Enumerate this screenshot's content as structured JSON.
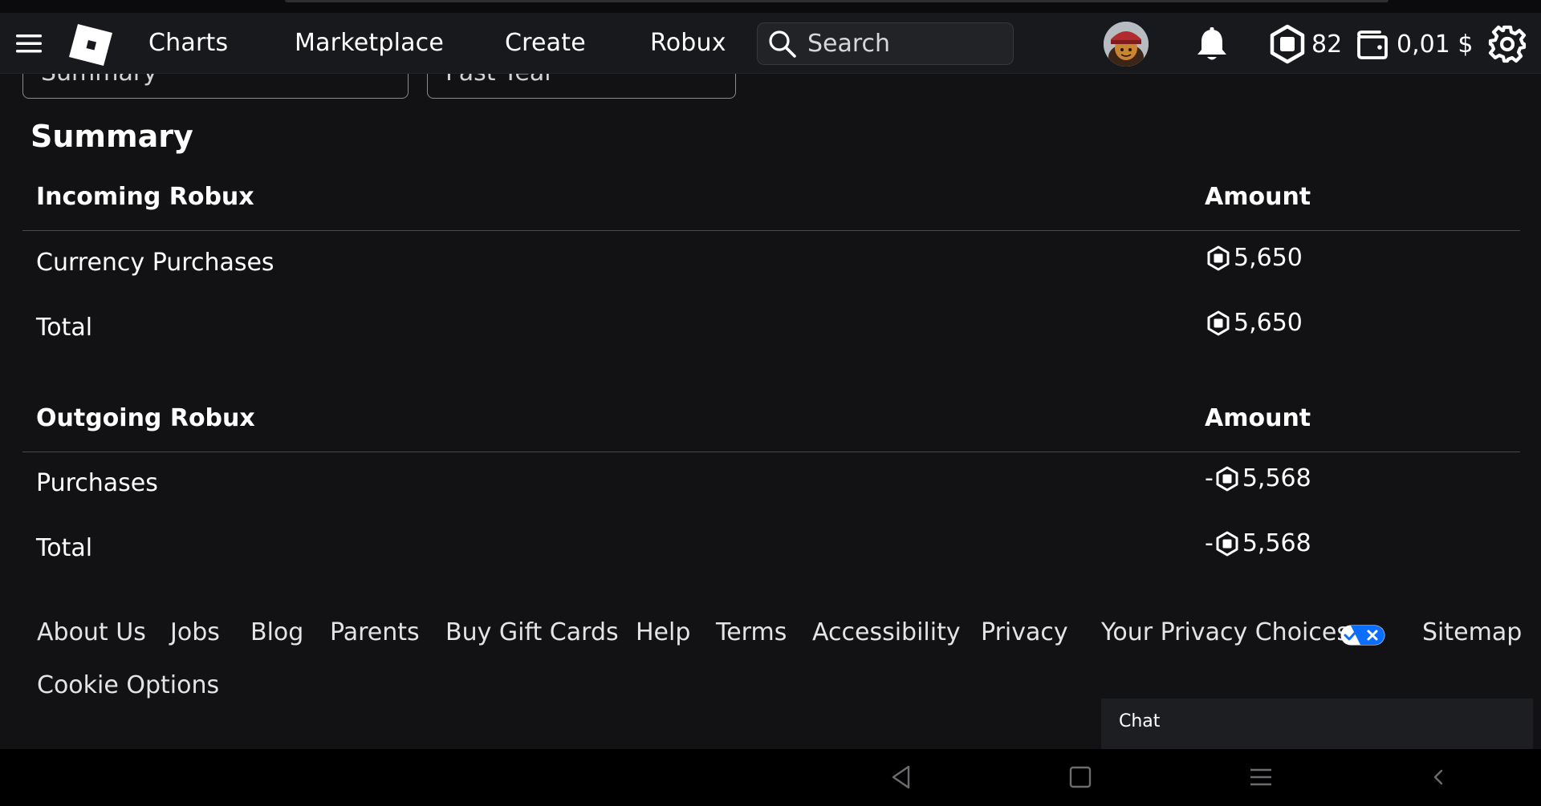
{
  "navbar": {
    "links": [
      "Charts",
      "Marketplace",
      "Create",
      "Robux"
    ],
    "search_placeholder": "Search",
    "robux_balance": "82",
    "wallet_balance": "0,01 $",
    "icons": [
      "menu-icon",
      "roblox-logo-icon",
      "search-icon",
      "avatar",
      "bell-icon",
      "robux-icon",
      "wallet-icon",
      "gear-icon"
    ]
  },
  "filters": {
    "type_value": "Summary",
    "period_value": "Past Year"
  },
  "summary": {
    "title": "Summary",
    "incoming": {
      "header": "Incoming Robux",
      "amount_header": "Amount",
      "rows": [
        {
          "label": "Currency Purchases",
          "sign": "",
          "value": "5,650"
        },
        {
          "label": "Total",
          "sign": "",
          "value": "5,650"
        }
      ]
    },
    "outgoing": {
      "header": "Outgoing Robux",
      "amount_header": "Amount",
      "rows": [
        {
          "label": "Purchases",
          "sign": "-",
          "value": "5,568"
        },
        {
          "label": "Total",
          "sign": "-",
          "value": "5,568"
        }
      ]
    }
  },
  "footer": {
    "links": [
      "About Us",
      "Jobs",
      "Blog",
      "Parents",
      "Buy Gift Cards",
      "Help",
      "Terms",
      "Accessibility",
      "Privacy",
      "Your Privacy Choices",
      "Sitemap",
      "Cookie Options"
    ]
  },
  "chat": {
    "label": "Chat"
  },
  "colors": {
    "background": "#121215",
    "navbar": "#18191c",
    "privacy_toggle_blue": "#0b6efd"
  }
}
